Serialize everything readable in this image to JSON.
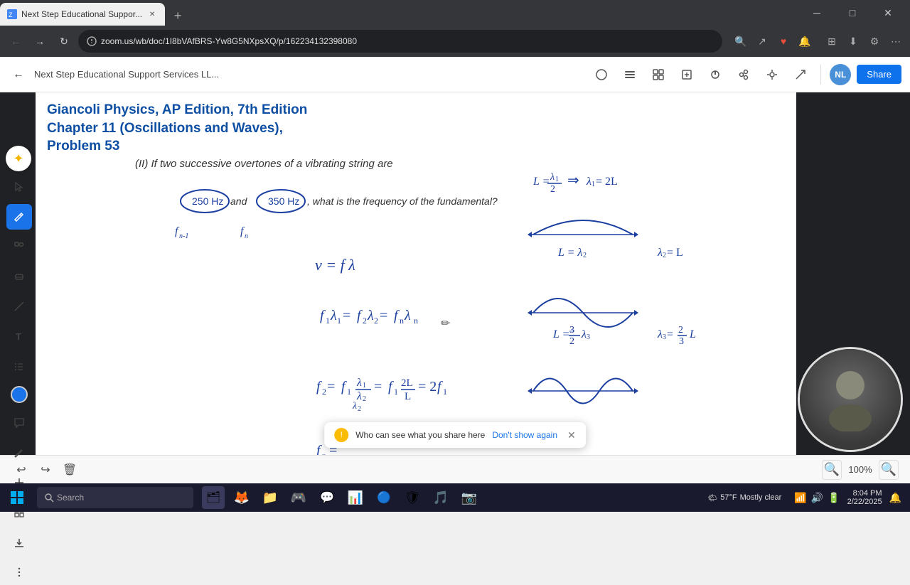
{
  "browser": {
    "tab_title": "Next Step Educational Suppor...",
    "address": "zoom.us/wb/doc/1I8bVAfBRS-Yw8G5NXpsXQ/p/162234132398080",
    "win_minimize": "─",
    "win_maximize": "□",
    "win_close": "✕"
  },
  "zoom_toolbar": {
    "back_label": "←",
    "title": "Next Step Educational Support Services LL...",
    "share_label": "Share",
    "avatar": "NL"
  },
  "whiteboard": {
    "title_line1": "Giancoli Physics, AP Edition, 7th Edition",
    "title_line2": "Chapter 11 (Oscillations and Waves),",
    "title_line3": "Problem 53"
  },
  "notification": {
    "text": "Who can see what you share here",
    "link": "Don't show again"
  },
  "zoom_bottom": {
    "percentage": "100%"
  },
  "taskbar": {
    "search_placeholder": "Search",
    "time": "8:04 PM",
    "date": "2/22/2025",
    "weather": "57°F",
    "weather_desc": "Mostly clear"
  }
}
